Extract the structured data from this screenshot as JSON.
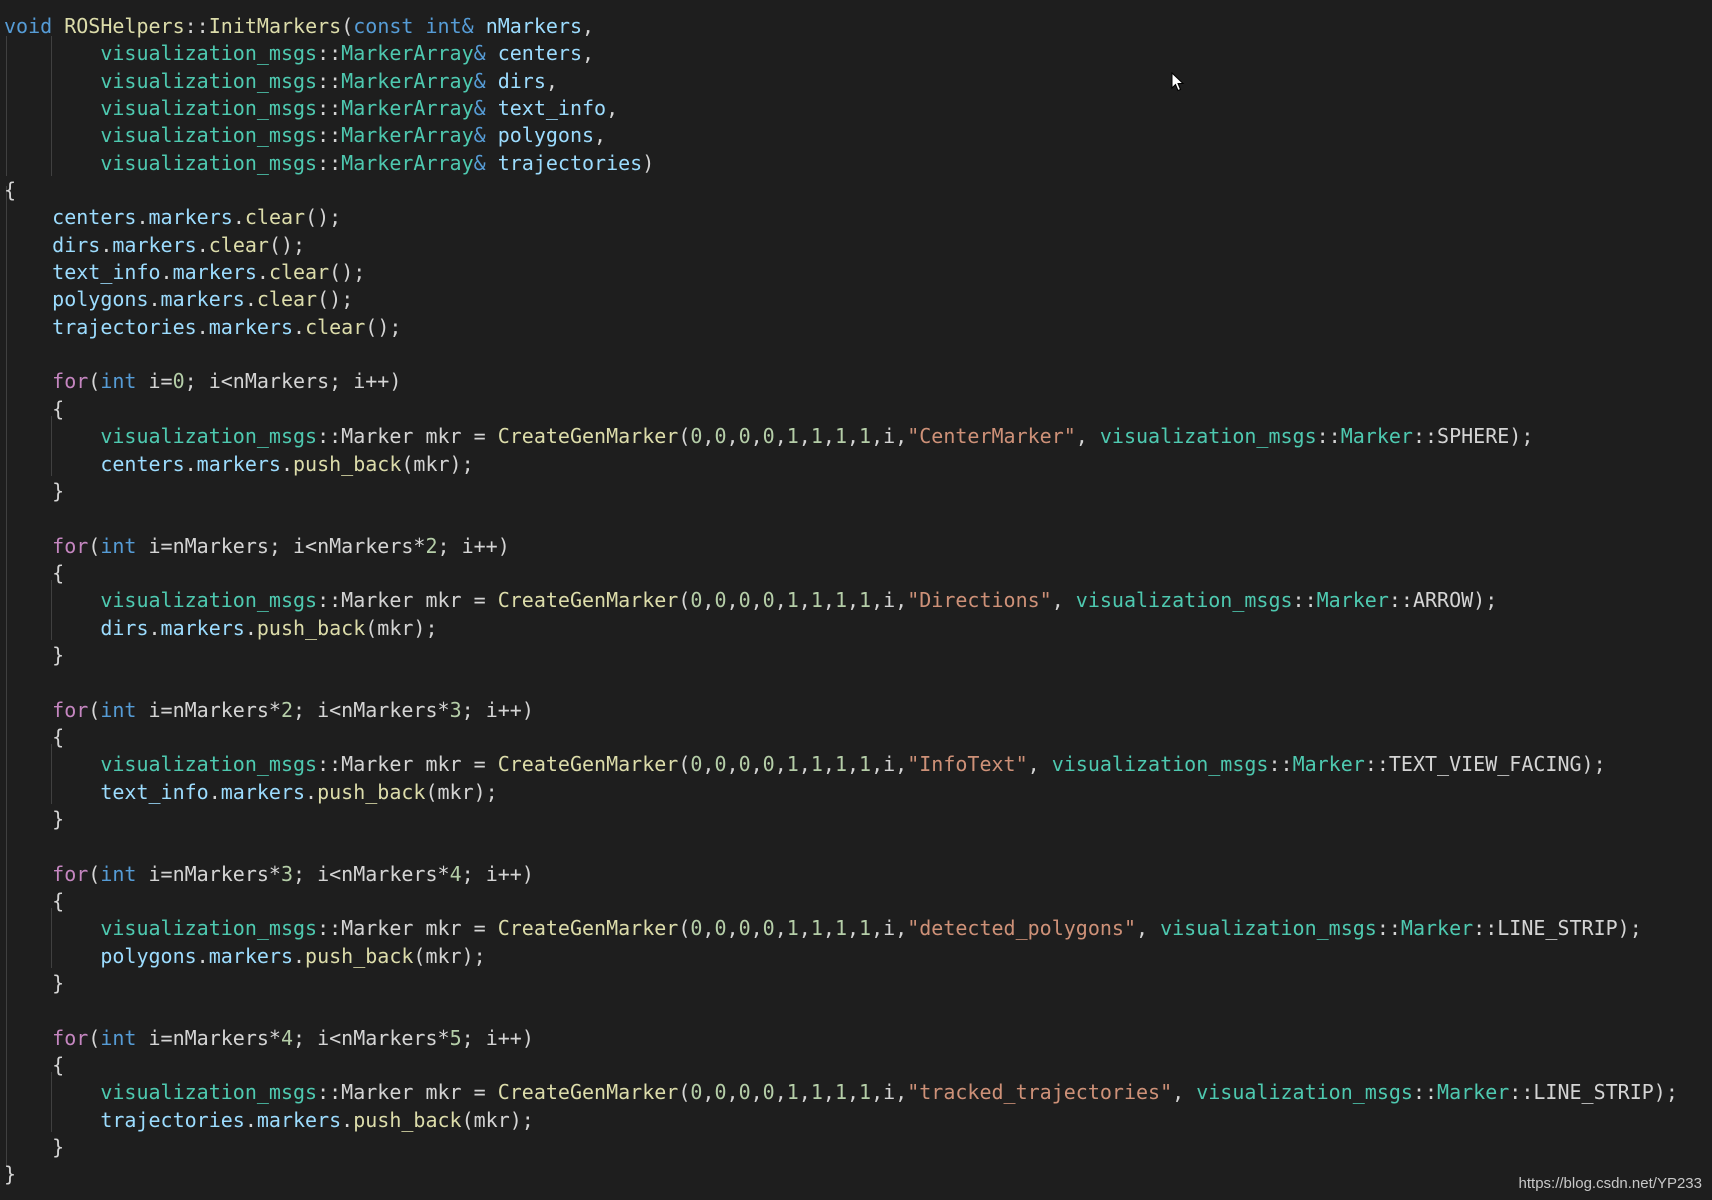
{
  "colors": {
    "background": "#1e1e1e",
    "keyword": "#569cd6",
    "control": "#c586c0",
    "function": "#dcdcaa",
    "type": "#4ec9b0",
    "variable": "#9cdcfe",
    "number": "#b5cea8",
    "string": "#ce9178",
    "punctuation": "#d4d4d4"
  },
  "icons": {
    "cursor": "mouse-pointer-icon"
  },
  "watermark": "https://blog.csdn.net/YP233",
  "code_lines": [
    [
      [
        "kw",
        "void"
      ],
      [
        "p",
        " "
      ],
      [
        "fn",
        "ROSHelpers"
      ],
      [
        "p",
        "::"
      ],
      [
        "fn",
        "InitMarkers"
      ],
      [
        "p",
        "("
      ],
      [
        "kw",
        "const"
      ],
      [
        "p",
        " "
      ],
      [
        "kw",
        "int"
      ],
      [
        "kw",
        "&"
      ],
      [
        "p",
        " "
      ],
      [
        "var",
        "nMarkers"
      ],
      [
        "p",
        ","
      ]
    ],
    [
      [
        "p",
        "        "
      ],
      [
        "type",
        "visualization_msgs"
      ],
      [
        "p",
        "::"
      ],
      [
        "type",
        "MarkerArray"
      ],
      [
        "kw",
        "&"
      ],
      [
        "p",
        " "
      ],
      [
        "var",
        "centers"
      ],
      [
        "p",
        ","
      ]
    ],
    [
      [
        "p",
        "        "
      ],
      [
        "type",
        "visualization_msgs"
      ],
      [
        "p",
        "::"
      ],
      [
        "type",
        "MarkerArray"
      ],
      [
        "kw",
        "&"
      ],
      [
        "p",
        " "
      ],
      [
        "var",
        "dirs"
      ],
      [
        "p",
        ","
      ]
    ],
    [
      [
        "p",
        "        "
      ],
      [
        "type",
        "visualization_msgs"
      ],
      [
        "p",
        "::"
      ],
      [
        "type",
        "MarkerArray"
      ],
      [
        "kw",
        "&"
      ],
      [
        "p",
        " "
      ],
      [
        "var",
        "text_info"
      ],
      [
        "p",
        ","
      ]
    ],
    [
      [
        "p",
        "        "
      ],
      [
        "type",
        "visualization_msgs"
      ],
      [
        "p",
        "::"
      ],
      [
        "type",
        "MarkerArray"
      ],
      [
        "kw",
        "&"
      ],
      [
        "p",
        " "
      ],
      [
        "var",
        "polygons"
      ],
      [
        "p",
        ","
      ]
    ],
    [
      [
        "p",
        "        "
      ],
      [
        "type",
        "visualization_msgs"
      ],
      [
        "p",
        "::"
      ],
      [
        "type",
        "MarkerArray"
      ],
      [
        "kw",
        "&"
      ],
      [
        "p",
        " "
      ],
      [
        "var",
        "trajectories"
      ],
      [
        "p",
        ")"
      ]
    ],
    [
      [
        "p",
        "{"
      ]
    ],
    [
      [
        "p",
        "    "
      ],
      [
        "var",
        "centers"
      ],
      [
        "p",
        "."
      ],
      [
        "var",
        "markers"
      ],
      [
        "p",
        "."
      ],
      [
        "fn",
        "clear"
      ],
      [
        "p",
        "();"
      ]
    ],
    [
      [
        "p",
        "    "
      ],
      [
        "var",
        "dirs"
      ],
      [
        "p",
        "."
      ],
      [
        "var",
        "markers"
      ],
      [
        "p",
        "."
      ],
      [
        "fn",
        "clear"
      ],
      [
        "p",
        "();"
      ]
    ],
    [
      [
        "p",
        "    "
      ],
      [
        "var",
        "text_info"
      ],
      [
        "p",
        "."
      ],
      [
        "var",
        "markers"
      ],
      [
        "p",
        "."
      ],
      [
        "fn",
        "clear"
      ],
      [
        "p",
        "();"
      ]
    ],
    [
      [
        "p",
        "    "
      ],
      [
        "var",
        "polygons"
      ],
      [
        "p",
        "."
      ],
      [
        "var",
        "markers"
      ],
      [
        "p",
        "."
      ],
      [
        "fn",
        "clear"
      ],
      [
        "p",
        "();"
      ]
    ],
    [
      [
        "p",
        "    "
      ],
      [
        "var",
        "trajectories"
      ],
      [
        "p",
        "."
      ],
      [
        "var",
        "markers"
      ],
      [
        "p",
        "."
      ],
      [
        "fn",
        "clear"
      ],
      [
        "p",
        "();"
      ]
    ],
    [
      [
        "p",
        ""
      ]
    ],
    [
      [
        "p",
        "    "
      ],
      [
        "ctl",
        "for"
      ],
      [
        "p",
        "("
      ],
      [
        "kw",
        "int"
      ],
      [
        "p",
        " i="
      ],
      [
        "num",
        "0"
      ],
      [
        "p",
        "; i<nMarkers; i++)"
      ]
    ],
    [
      [
        "p",
        "    {"
      ]
    ],
    [
      [
        "p",
        "        "
      ],
      [
        "type",
        "visualization_msgs"
      ],
      [
        "p",
        "::Marker mkr = "
      ],
      [
        "fn",
        "CreateGenMarker"
      ],
      [
        "p",
        "("
      ],
      [
        "num",
        "0"
      ],
      [
        "p",
        ","
      ],
      [
        "num",
        "0"
      ],
      [
        "p",
        ","
      ],
      [
        "num",
        "0"
      ],
      [
        "p",
        ","
      ],
      [
        "num",
        "0"
      ],
      [
        "p",
        ","
      ],
      [
        "num",
        "1"
      ],
      [
        "p",
        ","
      ],
      [
        "num",
        "1"
      ],
      [
        "p",
        ","
      ],
      [
        "num",
        "1"
      ],
      [
        "p",
        ","
      ],
      [
        "num",
        "1"
      ],
      [
        "p",
        ",i,"
      ],
      [
        "str",
        "\"CenterMarker\""
      ],
      [
        "p",
        ", "
      ],
      [
        "type",
        "visualization_msgs"
      ],
      [
        "p",
        "::"
      ],
      [
        "type",
        "Marker"
      ],
      [
        "p",
        "::SPHERE);"
      ]
    ],
    [
      [
        "p",
        "        "
      ],
      [
        "var",
        "centers"
      ],
      [
        "p",
        "."
      ],
      [
        "var",
        "markers"
      ],
      [
        "p",
        "."
      ],
      [
        "fn",
        "push_back"
      ],
      [
        "p",
        "(mkr);"
      ]
    ],
    [
      [
        "p",
        "    }"
      ]
    ],
    [
      [
        "p",
        ""
      ]
    ],
    [
      [
        "p",
        "    "
      ],
      [
        "ctl",
        "for"
      ],
      [
        "p",
        "("
      ],
      [
        "kw",
        "int"
      ],
      [
        "p",
        " i=nMarkers; i<nMarkers*"
      ],
      [
        "num",
        "2"
      ],
      [
        "p",
        "; i++)"
      ]
    ],
    [
      [
        "p",
        "    {"
      ]
    ],
    [
      [
        "p",
        "        "
      ],
      [
        "type",
        "visualization_msgs"
      ],
      [
        "p",
        "::Marker mkr = "
      ],
      [
        "fn",
        "CreateGenMarker"
      ],
      [
        "p",
        "("
      ],
      [
        "num",
        "0"
      ],
      [
        "p",
        ","
      ],
      [
        "num",
        "0"
      ],
      [
        "p",
        ","
      ],
      [
        "num",
        "0"
      ],
      [
        "p",
        ","
      ],
      [
        "num",
        "0"
      ],
      [
        "p",
        ","
      ],
      [
        "num",
        "1"
      ],
      [
        "p",
        ","
      ],
      [
        "num",
        "1"
      ],
      [
        "p",
        ","
      ],
      [
        "num",
        "1"
      ],
      [
        "p",
        ","
      ],
      [
        "num",
        "1"
      ],
      [
        "p",
        ",i,"
      ],
      [
        "str",
        "\"Directions\""
      ],
      [
        "p",
        ", "
      ],
      [
        "type",
        "visualization_msgs"
      ],
      [
        "p",
        "::"
      ],
      [
        "type",
        "Marker"
      ],
      [
        "p",
        "::ARROW);"
      ]
    ],
    [
      [
        "p",
        "        "
      ],
      [
        "var",
        "dirs"
      ],
      [
        "p",
        "."
      ],
      [
        "var",
        "markers"
      ],
      [
        "p",
        "."
      ],
      [
        "fn",
        "push_back"
      ],
      [
        "p",
        "(mkr);"
      ]
    ],
    [
      [
        "p",
        "    }"
      ]
    ],
    [
      [
        "p",
        ""
      ]
    ],
    [
      [
        "p",
        "    "
      ],
      [
        "ctl",
        "for"
      ],
      [
        "p",
        "("
      ],
      [
        "kw",
        "int"
      ],
      [
        "p",
        " i=nMarkers*"
      ],
      [
        "num",
        "2"
      ],
      [
        "p",
        "; i<nMarkers*"
      ],
      [
        "num",
        "3"
      ],
      [
        "p",
        "; i++)"
      ]
    ],
    [
      [
        "p",
        "    {"
      ]
    ],
    [
      [
        "p",
        "        "
      ],
      [
        "type",
        "visualization_msgs"
      ],
      [
        "p",
        "::Marker mkr = "
      ],
      [
        "fn",
        "CreateGenMarker"
      ],
      [
        "p",
        "("
      ],
      [
        "num",
        "0"
      ],
      [
        "p",
        ","
      ],
      [
        "num",
        "0"
      ],
      [
        "p",
        ","
      ],
      [
        "num",
        "0"
      ],
      [
        "p",
        ","
      ],
      [
        "num",
        "0"
      ],
      [
        "p",
        ","
      ],
      [
        "num",
        "1"
      ],
      [
        "p",
        ","
      ],
      [
        "num",
        "1"
      ],
      [
        "p",
        ","
      ],
      [
        "num",
        "1"
      ],
      [
        "p",
        ","
      ],
      [
        "num",
        "1"
      ],
      [
        "p",
        ",i,"
      ],
      [
        "str",
        "\"InfoText\""
      ],
      [
        "p",
        ", "
      ],
      [
        "type",
        "visualization_msgs"
      ],
      [
        "p",
        "::"
      ],
      [
        "type",
        "Marker"
      ],
      [
        "p",
        "::TEXT_VIEW_FACING);"
      ]
    ],
    [
      [
        "p",
        "        "
      ],
      [
        "var",
        "text_info"
      ],
      [
        "p",
        "."
      ],
      [
        "var",
        "markers"
      ],
      [
        "p",
        "."
      ],
      [
        "fn",
        "push_back"
      ],
      [
        "p",
        "(mkr);"
      ]
    ],
    [
      [
        "p",
        "    }"
      ]
    ],
    [
      [
        "p",
        ""
      ]
    ],
    [
      [
        "p",
        "    "
      ],
      [
        "ctl",
        "for"
      ],
      [
        "p",
        "("
      ],
      [
        "kw",
        "int"
      ],
      [
        "p",
        " i=nMarkers*"
      ],
      [
        "num",
        "3"
      ],
      [
        "p",
        "; i<nMarkers*"
      ],
      [
        "num",
        "4"
      ],
      [
        "p",
        "; i++)"
      ]
    ],
    [
      [
        "p",
        "    {"
      ]
    ],
    [
      [
        "p",
        "        "
      ],
      [
        "type",
        "visualization_msgs"
      ],
      [
        "p",
        "::Marker mkr = "
      ],
      [
        "fn",
        "CreateGenMarker"
      ],
      [
        "p",
        "("
      ],
      [
        "num",
        "0"
      ],
      [
        "p",
        ","
      ],
      [
        "num",
        "0"
      ],
      [
        "p",
        ","
      ],
      [
        "num",
        "0"
      ],
      [
        "p",
        ","
      ],
      [
        "num",
        "0"
      ],
      [
        "p",
        ","
      ],
      [
        "num",
        "1"
      ],
      [
        "p",
        ","
      ],
      [
        "num",
        "1"
      ],
      [
        "p",
        ","
      ],
      [
        "num",
        "1"
      ],
      [
        "p",
        ","
      ],
      [
        "num",
        "1"
      ],
      [
        "p",
        ",i,"
      ],
      [
        "str",
        "\"detected_polygons\""
      ],
      [
        "p",
        ", "
      ],
      [
        "type",
        "visualization_msgs"
      ],
      [
        "p",
        "::"
      ],
      [
        "type",
        "Marker"
      ],
      [
        "p",
        "::LINE_STRIP);"
      ]
    ],
    [
      [
        "p",
        "        "
      ],
      [
        "var",
        "polygons"
      ],
      [
        "p",
        "."
      ],
      [
        "var",
        "markers"
      ],
      [
        "p",
        "."
      ],
      [
        "fn",
        "push_back"
      ],
      [
        "p",
        "(mkr);"
      ]
    ],
    [
      [
        "p",
        "    }"
      ]
    ],
    [
      [
        "p",
        ""
      ]
    ],
    [
      [
        "p",
        "    "
      ],
      [
        "ctl",
        "for"
      ],
      [
        "p",
        "("
      ],
      [
        "kw",
        "int"
      ],
      [
        "p",
        " i=nMarkers*"
      ],
      [
        "num",
        "4"
      ],
      [
        "p",
        "; i<nMarkers*"
      ],
      [
        "num",
        "5"
      ],
      [
        "p",
        "; i++)"
      ]
    ],
    [
      [
        "p",
        "    {"
      ]
    ],
    [
      [
        "p",
        "        "
      ],
      [
        "type",
        "visualization_msgs"
      ],
      [
        "p",
        "::Marker mkr = "
      ],
      [
        "fn",
        "CreateGenMarker"
      ],
      [
        "p",
        "("
      ],
      [
        "num",
        "0"
      ],
      [
        "p",
        ","
      ],
      [
        "num",
        "0"
      ],
      [
        "p",
        ","
      ],
      [
        "num",
        "0"
      ],
      [
        "p",
        ","
      ],
      [
        "num",
        "0"
      ],
      [
        "p",
        ","
      ],
      [
        "num",
        "1"
      ],
      [
        "p",
        ","
      ],
      [
        "num",
        "1"
      ],
      [
        "p",
        ","
      ],
      [
        "num",
        "1"
      ],
      [
        "p",
        ","
      ],
      [
        "num",
        "1"
      ],
      [
        "p",
        ",i,"
      ],
      [
        "str",
        "\"tracked_trajectories\""
      ],
      [
        "p",
        ", "
      ],
      [
        "type",
        "visualization_msgs"
      ],
      [
        "p",
        "::"
      ],
      [
        "type",
        "Marker"
      ],
      [
        "p",
        "::LINE_STRIP);"
      ]
    ],
    [
      [
        "p",
        "        "
      ],
      [
        "var",
        "trajectories"
      ],
      [
        "p",
        "."
      ],
      [
        "var",
        "markers"
      ],
      [
        "p",
        "."
      ],
      [
        "fn",
        "push_back"
      ],
      [
        "p",
        "(mkr);"
      ]
    ],
    [
      [
        "p",
        "    }"
      ]
    ],
    [
      [
        "p",
        "}"
      ]
    ]
  ]
}
